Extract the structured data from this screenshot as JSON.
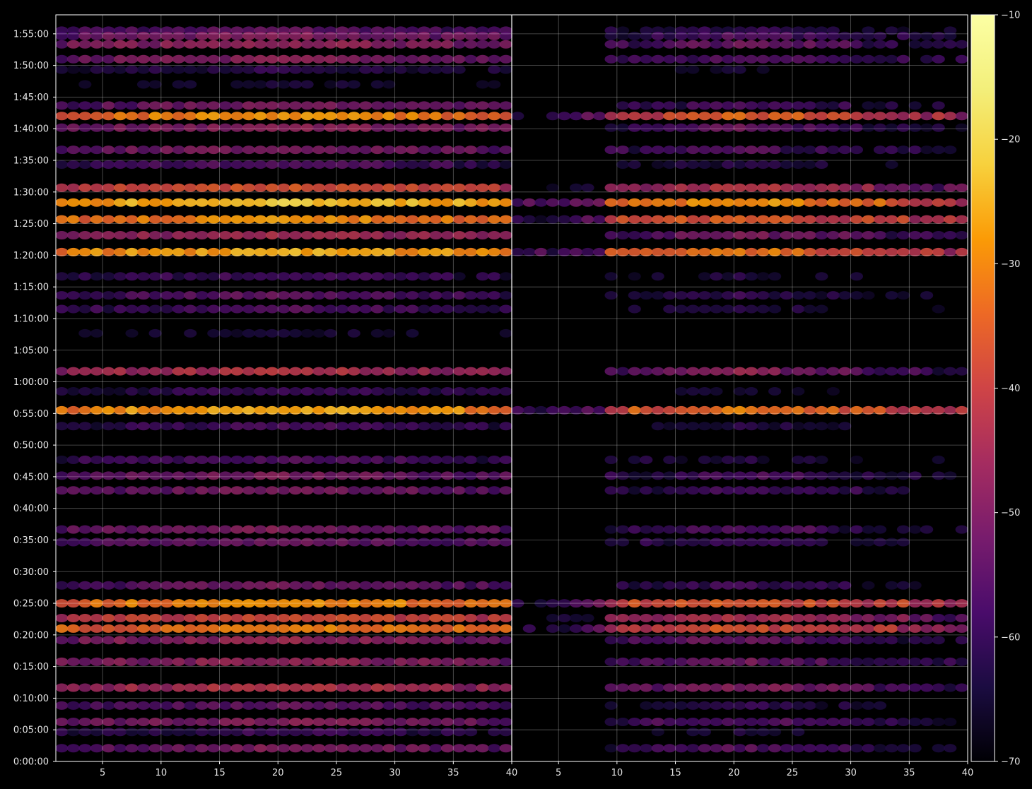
{
  "chart_data": {
    "type": "heatmap",
    "title": "",
    "xlabel": "",
    "ylabel": "",
    "colormap": "inferno",
    "background": "#000000",
    "grid": true,
    "panels": [
      {
        "name": "",
        "xlim": [
          1,
          40
        ],
        "x_ticks": [
          5,
          10,
          15,
          20,
          25,
          30,
          35
        ],
        "x_tick_labels": [
          "5",
          "10",
          "15",
          "20",
          "25",
          "30",
          "35"
        ],
        "x_end_label": "40"
      },
      {
        "name": "",
        "xlim": [
          1,
          40
        ],
        "x_ticks": [
          5,
          10,
          15,
          20,
          25,
          30,
          35,
          40
        ],
        "x_tick_labels": [
          "5",
          "10",
          "15",
          "20",
          "25",
          "30",
          "35",
          "40"
        ]
      }
    ],
    "ylim_seconds": [
      0,
      7080
    ],
    "y_ticks_seconds": [
      0,
      300,
      600,
      900,
      1200,
      1500,
      1800,
      2100,
      2400,
      2700,
      3000,
      3300,
      3600,
      3900,
      4200,
      4500,
      4800,
      5100,
      5400,
      5700,
      6000,
      6300,
      6600,
      6900
    ],
    "y_tick_labels": [
      "0:00:00",
      "0:05:00",
      "0:10:00",
      "0:15:00",
      "0:20:00",
      "0:25:00",
      "0:30:00",
      "0:35:00",
      "0:40:00",
      "0:45:00",
      "0:50:00",
      "0:55:00",
      "1:00:00",
      "1:05:00",
      "1:10:00",
      "1:15:00",
      "1:20:00",
      "1:25:00",
      "1:30:00",
      "1:35:00",
      "1:40:00",
      "1:45:00",
      "1:50:00",
      "1:55:00"
    ],
    "colorbar": {
      "range": [
        -70,
        -10
      ],
      "ticks": [
        -10,
        -20,
        -30,
        -40,
        -50,
        -60,
        -70
      ],
      "tick_labels": [
        "−10",
        "−20",
        "−30",
        "−40",
        "−50",
        "−60",
        "−70"
      ]
    },
    "row_profile": {
      "note_units": "time in seconds, level in data units (dB) at the loudest frequency",
      "rows": [
        {
          "t": 6930,
          "level": -47
        },
        {
          "t": 6880,
          "level": -43
        },
        {
          "t": 6800,
          "level": -40
        },
        {
          "t": 6660,
          "level": -42
        },
        {
          "t": 6560,
          "level": -54
        },
        {
          "t": 6420,
          "level": -58
        },
        {
          "t": 6220,
          "level": -44
        },
        {
          "t": 6120,
          "level": -22
        },
        {
          "t": 6010,
          "level": -41
        },
        {
          "t": 5800,
          "level": -43
        },
        {
          "t": 5660,
          "level": -49
        },
        {
          "t": 5440,
          "level": -30
        },
        {
          "t": 5300,
          "level": -16
        },
        {
          "t": 5140,
          "level": -22
        },
        {
          "t": 4990,
          "level": -38
        },
        {
          "t": 4830,
          "level": -19
        },
        {
          "t": 4600,
          "level": -51
        },
        {
          "t": 4420,
          "level": -47
        },
        {
          "t": 4290,
          "level": -49
        },
        {
          "t": 4060,
          "level": -57
        },
        {
          "t": 3700,
          "level": -36
        },
        {
          "t": 3510,
          "level": -52
        },
        {
          "t": 3330,
          "level": -19
        },
        {
          "t": 3180,
          "level": -50
        },
        {
          "t": 2860,
          "level": -49
        },
        {
          "t": 2710,
          "level": -44
        },
        {
          "t": 2570,
          "level": -44
        },
        {
          "t": 2200,
          "level": -43
        },
        {
          "t": 2080,
          "level": -46
        },
        {
          "t": 1670,
          "level": -45
        },
        {
          "t": 1500,
          "level": -22
        },
        {
          "t": 1360,
          "level": -31
        },
        {
          "t": 1260,
          "level": -24
        },
        {
          "t": 1150,
          "level": -40
        },
        {
          "t": 945,
          "level": -40
        },
        {
          "t": 700,
          "level": -36
        },
        {
          "t": 530,
          "level": -47
        },
        {
          "t": 375,
          "level": -42
        },
        {
          "t": 280,
          "level": -52
        },
        {
          "t": 125,
          "level": -43
        }
      ]
    }
  }
}
